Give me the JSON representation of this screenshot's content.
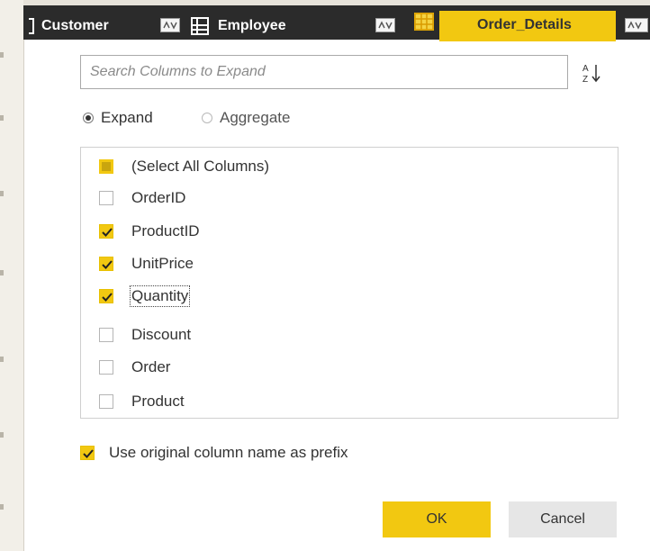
{
  "tabs": [
    {
      "label": "Customer"
    },
    {
      "label": "Employee"
    },
    {
      "label": "Order_Details"
    }
  ],
  "search": {
    "placeholder": "Search Columns to Expand",
    "value": ""
  },
  "sort_icon": "sort-az-icon",
  "mode": {
    "options": [
      {
        "label": "Expand",
        "selected": true
      },
      {
        "label": "Aggregate",
        "selected": false
      }
    ]
  },
  "columns": [
    {
      "label": "(Select All Columns)",
      "state": "partial"
    },
    {
      "label": "OrderID",
      "state": "unchecked"
    },
    {
      "label": "ProductID",
      "state": "checked"
    },
    {
      "label": "UnitPrice",
      "state": "checked"
    },
    {
      "label": "Quantity",
      "state": "checked"
    },
    {
      "label": "Discount",
      "state": "unchecked"
    },
    {
      "label": "Order",
      "state": "unchecked"
    },
    {
      "label": "Product",
      "state": "unchecked"
    }
  ],
  "prefix": {
    "label": "Use original column name as prefix",
    "checked": true
  },
  "buttons": {
    "ok": "OK",
    "cancel": "Cancel"
  },
  "colors": {
    "accent": "#f2c811",
    "header_bg": "#2b2b2b"
  }
}
